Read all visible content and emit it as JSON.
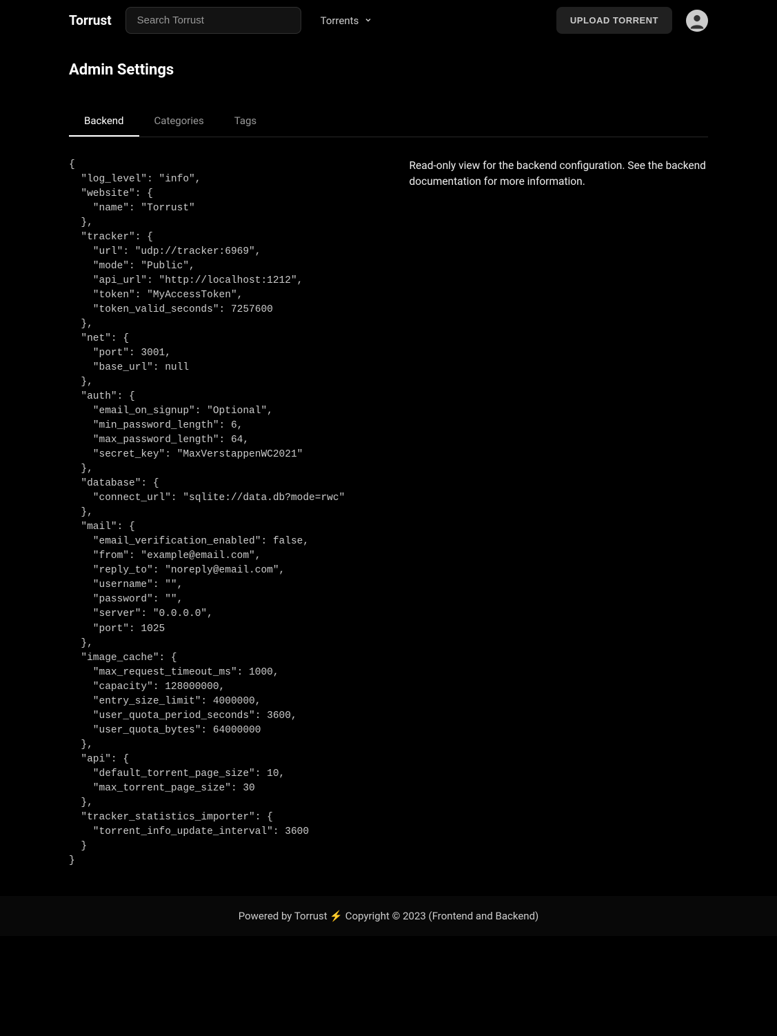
{
  "header": {
    "brand": "Torrust",
    "search_placeholder": "Search Torrust",
    "nav_dropdown_label": "Torrents",
    "upload_label": "UPLOAD TORRENT"
  },
  "page": {
    "title": "Admin Settings"
  },
  "tabs": {
    "backend": "Backend",
    "categories": "Categories",
    "tags": "Tags"
  },
  "description": "Read-only view for the backend configuration. See the backend documentation for more information.",
  "config_json": "{\n  \"log_level\": \"info\",\n  \"website\": {\n    \"name\": \"Torrust\"\n  },\n  \"tracker\": {\n    \"url\": \"udp://tracker:6969\",\n    \"mode\": \"Public\",\n    \"api_url\": \"http://localhost:1212\",\n    \"token\": \"MyAccessToken\",\n    \"token_valid_seconds\": 7257600\n  },\n  \"net\": {\n    \"port\": 3001,\n    \"base_url\": null\n  },\n  \"auth\": {\n    \"email_on_signup\": \"Optional\",\n    \"min_password_length\": 6,\n    \"max_password_length\": 64,\n    \"secret_key\": \"MaxVerstappenWC2021\"\n  },\n  \"database\": {\n    \"connect_url\": \"sqlite://data.db?mode=rwc\"\n  },\n  \"mail\": {\n    \"email_verification_enabled\": false,\n    \"from\": \"example@email.com\",\n    \"reply_to\": \"noreply@email.com\",\n    \"username\": \"\",\n    \"password\": \"\",\n    \"server\": \"0.0.0.0\",\n    \"port\": 1025\n  },\n  \"image_cache\": {\n    \"max_request_timeout_ms\": 1000,\n    \"capacity\": 128000000,\n    \"entry_size_limit\": 4000000,\n    \"user_quota_period_seconds\": 3600,\n    \"user_quota_bytes\": 64000000\n  },\n  \"api\": {\n    \"default_torrent_page_size\": 10,\n    \"max_torrent_page_size\": 30\n  },\n  \"tracker_statistics_importer\": {\n    \"torrent_info_update_interval\": 3600\n  }\n}",
  "footer": {
    "text": "Powered by Torrust ⚡ Copyright © 2023 (Frontend and Backend)"
  }
}
